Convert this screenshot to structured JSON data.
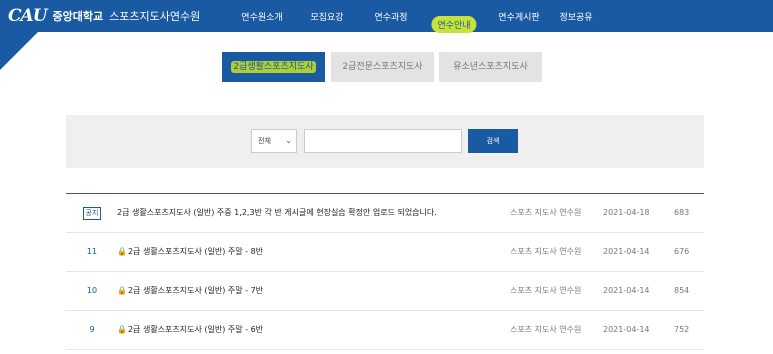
{
  "header": {
    "logo_mark": "CAU",
    "university": "중앙대학교",
    "institute": "스포츠지도사연수원",
    "nav": [
      "연수원소개",
      "모집요강",
      "연수과정",
      "연수안내",
      "연수게시판",
      "정보공유"
    ]
  },
  "tabs": [
    "2급생활스포츠지도사",
    "2급전문스포츠지도사",
    "유소년스포츠지도사"
  ],
  "search": {
    "select_value": "전체",
    "input_value": "",
    "button_label": "검색"
  },
  "posts": [
    {
      "no": "공지",
      "title": "2급 생활스포츠지도사 (일반) 주중 1,2,3반 각 반 게시글에 현장실습 확정안 업로드 되었습니다.",
      "author": "스포츠 지도사 연수원",
      "date": "2021-04-18",
      "views": "683"
    },
    {
      "no": "11",
      "title": "2급 생활스포츠지도사 (일반) 주말 - 8반",
      "author": "스포츠 지도사 연수원",
      "date": "2021-04-14",
      "views": "676"
    },
    {
      "no": "10",
      "title": "2급 생활스포츠지도사 (일반) 주말 - 7반",
      "author": "스포츠 지도사 연수원",
      "date": "2021-04-14",
      "views": "854"
    },
    {
      "no": "9",
      "title": "2급 생활스포츠지도사 (일반) 주말 - 6반",
      "author": "스포츠 지도사 연수원",
      "date": "2021-04-14",
      "views": "752"
    }
  ]
}
